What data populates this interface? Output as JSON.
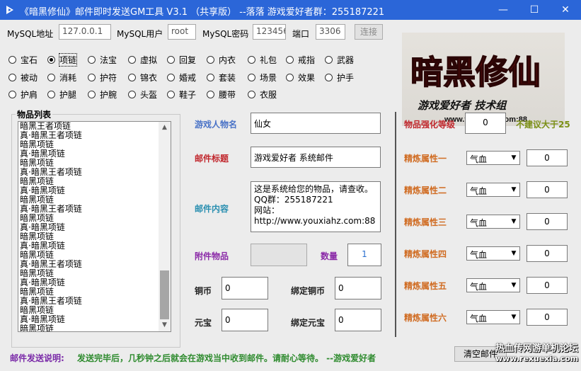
{
  "window": {
    "title": "《暗黑修仙》邮件即时发送GM工具 V3.1 （共享版） --落落 游戏爱好者群：255187221",
    "min_glyph": "—",
    "max_glyph": "☐",
    "close_glyph": "✕"
  },
  "db": {
    "host_label": "MySQL地址",
    "host_value": "127.0.0.1",
    "user_label": "MySQL用户",
    "user_value": "root",
    "pass_label": "MySQL密码",
    "pass_value": "123456",
    "port_label": "端口",
    "port_value": "3306",
    "connect_label": "连接"
  },
  "categories": [
    {
      "label": "宝石",
      "selected": false
    },
    {
      "label": "项链",
      "selected": true
    },
    {
      "label": "法宝",
      "selected": false
    },
    {
      "label": "虚拟",
      "selected": false
    },
    {
      "label": "回复",
      "selected": false
    },
    {
      "label": "内衣",
      "selected": false
    },
    {
      "label": "礼包",
      "selected": false
    },
    {
      "label": "戒指",
      "selected": false
    },
    {
      "label": "武器",
      "selected": false
    },
    {
      "label": "被动",
      "selected": false
    },
    {
      "label": "消耗",
      "selected": false
    },
    {
      "label": "护符",
      "selected": false
    },
    {
      "label": "锦衣",
      "selected": false
    },
    {
      "label": "婚戒",
      "selected": false
    },
    {
      "label": "套装",
      "selected": false
    },
    {
      "label": "场景",
      "selected": false
    },
    {
      "label": "效果",
      "selected": false
    },
    {
      "label": "护手",
      "selected": false
    },
    {
      "label": "护肩",
      "selected": false
    },
    {
      "label": "护腿",
      "selected": false
    },
    {
      "label": "护腕",
      "selected": false
    },
    {
      "label": "头盔",
      "selected": false
    },
    {
      "label": "鞋子",
      "selected": false
    },
    {
      "label": "腰带",
      "selected": false
    },
    {
      "label": "衣服",
      "selected": false
    }
  ],
  "logo": {
    "title": "暗黑修仙",
    "tagline": "游戏爱好者 技术组",
    "site": "www.youxiahz.com:88"
  },
  "item_list": {
    "title": "物品列表",
    "items": [
      "暗黑王者项链",
      "真·暗黑王者项链",
      "暗黑项链",
      "真·暗黑项链",
      "暗黑项链",
      "真·暗黑王者项链",
      "暗黑项链",
      "真·暗黑项链",
      "暗黑项链",
      "真·暗黑王者项链",
      "暗黑项链",
      "真·暗黑项链",
      "暗黑项链",
      "真·暗黑项链",
      "暗黑项链",
      "真·暗黑王者项链",
      "暗黑项链",
      "真·暗黑项链",
      "暗黑项链",
      "真·暗黑王者项链",
      "暗黑项链",
      "真·暗黑项链",
      "暗黑项链",
      "真·暗黑王者项链"
    ]
  },
  "mail": {
    "char_label": "游戏人物名",
    "char_value": "仙女",
    "subject_label": "邮件标题",
    "subject_value": "游戏爱好者 系统邮件",
    "body_label": "邮件内容",
    "body_value": "这是系统给您的物品，请查收。\nQQ群：255187221\n网站：\nhttp://www.youxiahz.com:88",
    "attach_label": "附件物品",
    "attach_value": "",
    "qty_label": "数量",
    "qty_value": "1",
    "copper_label": "铜币",
    "copper_value": "0",
    "bound_copper_label": "绑定铜币",
    "bound_copper_value": "0",
    "yuanbao_label": "元宝",
    "yuanbao_value": "0",
    "bound_yuanbao_label": "绑定元宝",
    "bound_yuanbao_value": "0"
  },
  "enhance": {
    "label": "物品强化等级",
    "value": "0",
    "hint": "不建议大于25",
    "refines": [
      {
        "label": "精炼属性一",
        "attr": "气血",
        "value": "0"
      },
      {
        "label": "精炼属性二",
        "attr": "气血",
        "value": "0"
      },
      {
        "label": "精炼属性三",
        "attr": "气血",
        "value": "0"
      },
      {
        "label": "精炼属性四",
        "attr": "气血",
        "value": "0"
      },
      {
        "label": "精炼属性五",
        "attr": "气血",
        "value": "0"
      },
      {
        "label": "精炼属性六",
        "attr": "气血",
        "value": "0"
      }
    ]
  },
  "footer": {
    "note_label": "邮件发送说明:",
    "note_text": "发送完毕后，几秒钟之后就会在游戏当中收到邮件。请耐心等待。  --游戏爱好者",
    "clear_label": "清空邮件",
    "watermark_line1": "热血传网游单机论坛",
    "watermark_line2": "www.rexuexia.com"
  },
  "colors": {
    "titlebar": "#2b66d8",
    "label_blue": "#4a73c7",
    "label_red": "#c1272d",
    "label_orange": "#d06b21",
    "hint_olive": "#7a8f14",
    "footer_green": "#2e8b2e"
  }
}
